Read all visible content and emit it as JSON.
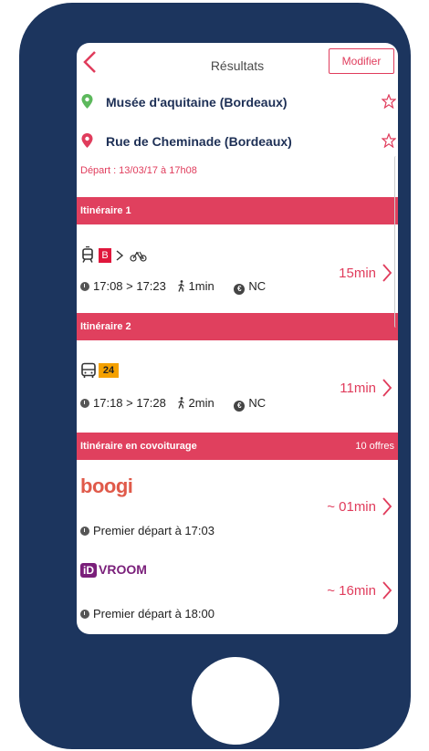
{
  "header": {
    "title": "Résultats",
    "modify_label": "Modifier"
  },
  "places": [
    {
      "name": "Musée d'aquitaine (Bordeaux)",
      "pin_color": "#5cb85c"
    },
    {
      "name": "Rue de Cheminade (Bordeaux)",
      "pin_color": "#e03c5c"
    }
  ],
  "depart_text": "Départ : 13/03/17 à 17h08",
  "itineraries": [
    {
      "label": "Itinéraire 1",
      "line": "B",
      "time_range": "17:08 > 17:23",
      "walk": "1min",
      "cost": "NC",
      "duration": "15min"
    },
    {
      "label": "Itinéraire 2",
      "line": "24",
      "time_range": "17:18 > 17:28",
      "walk": "2min",
      "cost": "NC",
      "duration": "11min"
    }
  ],
  "carpool": {
    "label": "Itinéraire en covoiturage",
    "offers": "10 offres",
    "items": [
      {
        "brand": "boogi",
        "first_departure": "Premier départ à 17:03",
        "duration": "~ 01min"
      },
      {
        "brand": "VROOM",
        "brand_prefix": "iD",
        "first_departure": "Premier départ à 18:00",
        "duration": "~ 16min"
      }
    ]
  },
  "colors": {
    "accent": "#e0405e",
    "frame": "#1c355e",
    "navy": "#1d2f55",
    "bus_badge": "#f5a100"
  }
}
